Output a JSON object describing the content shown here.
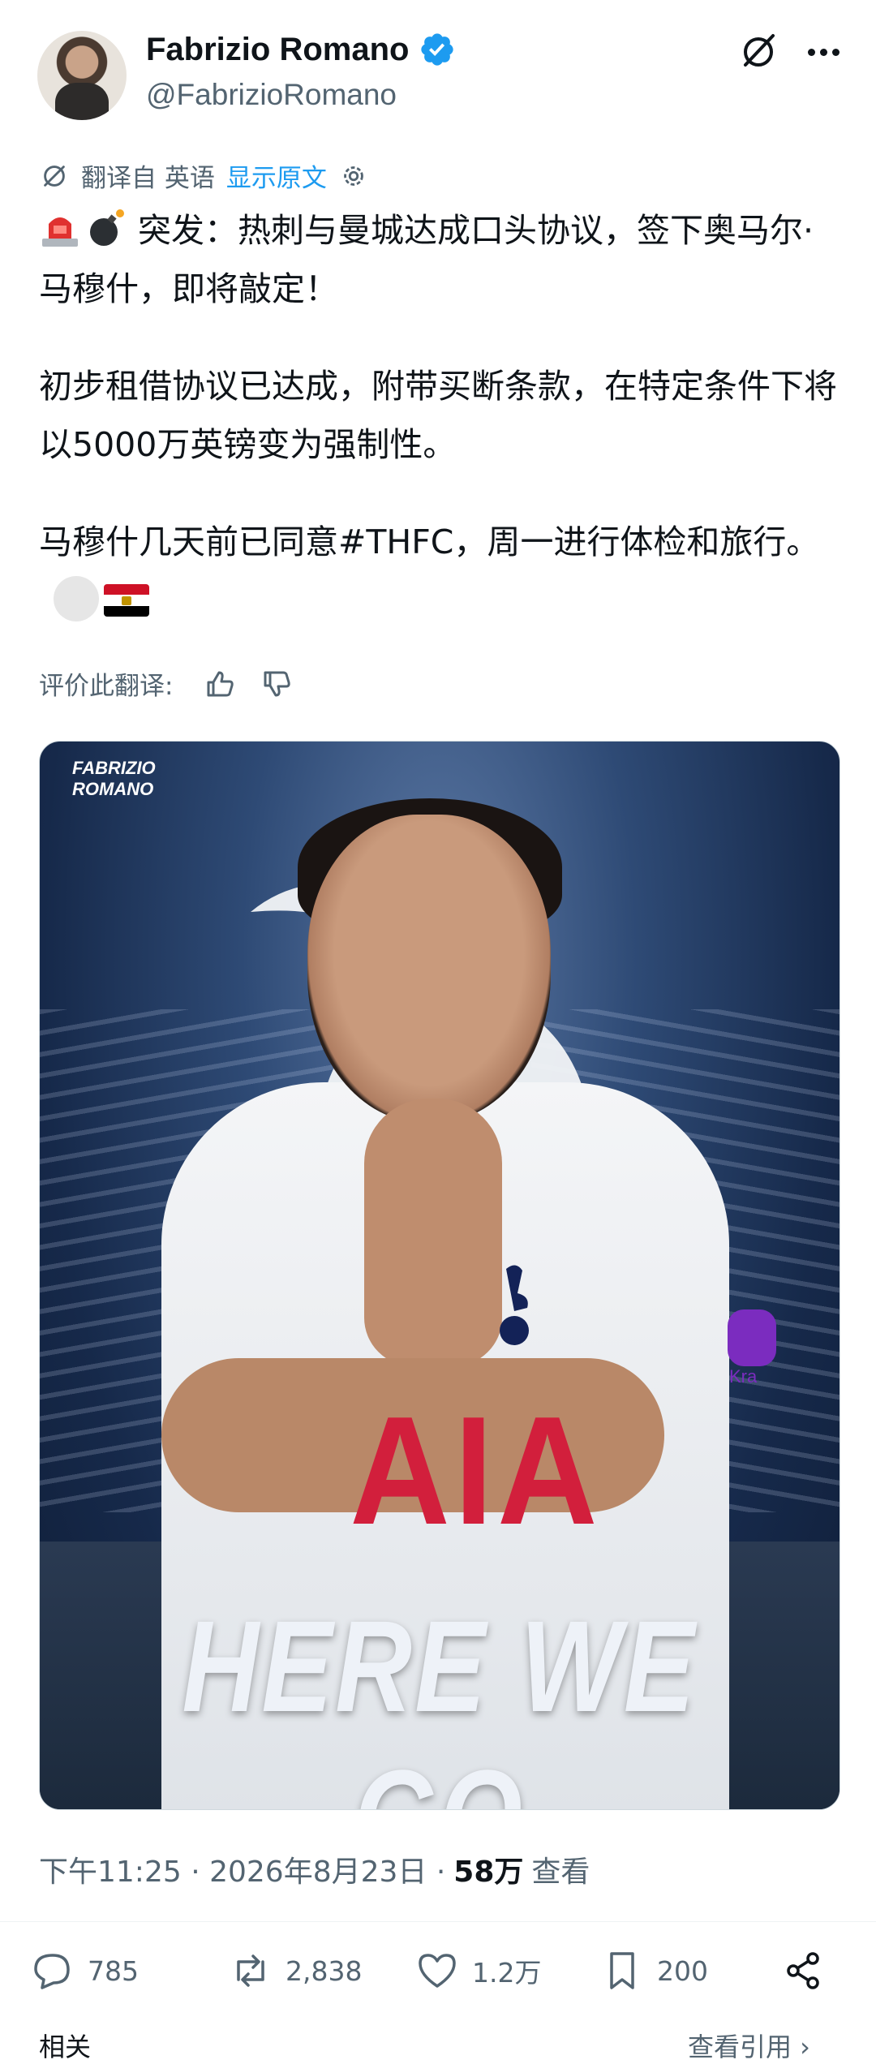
{
  "author": {
    "name": "Fabrizio Romano",
    "handle": "@FabrizioRomano",
    "verified": true,
    "verified_color": "#1d9bf0"
  },
  "header_icons": [
    "grok-icon",
    "more-icon"
  ],
  "translation": {
    "from_label": "翻译自 英语",
    "show_original": "显示原文",
    "rate_label": "评价此翻译:"
  },
  "tweet": {
    "line1": "突发：热刺与曼城达成口头协议，签下奥马尔·马穆什，即将敲定！",
    "line2": "初步租借协议已达成，附带买断条款，在特定条件下将以5000万英镑变为强制性。",
    "line3": "马穆什几天前已同意#THFC，周一进行体检和旅行。",
    "emoji_start": [
      "siren-emoji",
      "bomb-emoji"
    ],
    "emoji_end": [
      "placeholder-emoji",
      "egypt-flag-emoji"
    ]
  },
  "media": {
    "brand": "FABRIZIO\nROMANO",
    "headline": "HERE WE GO",
    "sponsor": "AIA",
    "kit_sponsor": "Kra"
  },
  "meta": {
    "time": "下午11:25 · 2026年8月23日 ·",
    "views_count": "58万",
    "views_label": "查看"
  },
  "actions": {
    "replies": "785",
    "reposts": "2,838",
    "likes": "1.2万",
    "bookmarks": "200"
  },
  "footer": {
    "left": "相关",
    "right": "查看引用 ›"
  },
  "colors": {
    "accent": "#1d9bf0",
    "secondary_text": "#536471",
    "primary_text": "#0f1419"
  }
}
